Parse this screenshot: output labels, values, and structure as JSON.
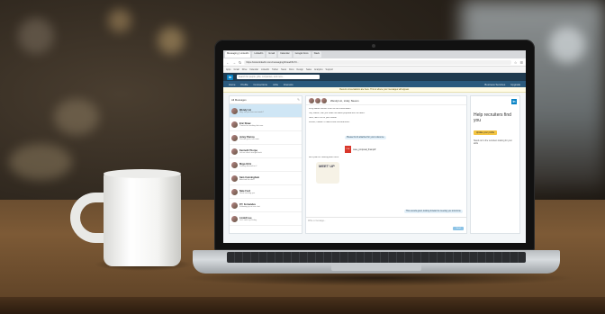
{
  "browser": {
    "tabs": [
      "Messaging | LinkedIn",
      "LinkedIn",
      "Gmail",
      "Calendar",
      "Google Docs",
      "Slack"
    ],
    "url": "https://www.linkedin.com/messaging/thread/6173...",
    "bookmarks": [
      "Apps",
      "Gmail",
      "Drive",
      "Calendar",
      "LinkedIn",
      "Twitter",
      "News",
      "Docs",
      "Design",
      "Sales",
      "Analytics",
      "Support"
    ]
  },
  "linkedin": {
    "logo": "in",
    "search_placeholder": "Search for people, jobs, companies, and more...",
    "nav": [
      "Home",
      "Profile",
      "Connections",
      "Jobs",
      "Interests"
    ],
    "nav_right": [
      "Business Services",
      "Upgrade"
    ],
    "banner": "Recent conversations are here. This is where your messages will appear."
  },
  "messaging": {
    "list_title": "All Messages",
    "conversations": [
      {
        "name": "Wendy Lin",
        "snippet": "Hey, are you free next week?",
        "date": ""
      },
      {
        "name": "Eric Shaw",
        "snippet": "Thanks for sending that over",
        "date": ""
      },
      {
        "name": "Jenny Ramos",
        "snippet": "Sounds great, talk soon",
        "date": ""
      },
      {
        "name": "Kenneth Thorpe",
        "snippet": "Let me check and get back",
        "date": ""
      },
      {
        "name": "Maya Ortiz",
        "snippet": "Looking forward to it!",
        "date": ""
      },
      {
        "name": "Sam Cunningham",
        "snippet": "Attached the deck",
        "date": ""
      },
      {
        "name": "Nate Ford",
        "snippet": "Great meeting you",
        "date": ""
      },
      {
        "name": "P.T. Fernandes",
        "snippet": "Following up on our chat",
        "date": ""
      },
      {
        "name": "Lindell Lee",
        "snippet": "Let's catch up Friday",
        "date": ""
      }
    ],
    "thread_title": "Wendy Lin, Lindy, Steven",
    "thread_lines": [
      "Lindy added Steven Chen to the conversation",
      "Hey Steven, can you share the latest proposal with the team?",
      "Sure, here it is for your review.",
      "Perfect, thanks! I'll take a look this afternoon.",
      "Let's plan on meeting after lunch."
    ],
    "bubble_1": "Please find it attached for your reference.",
    "pdf_name": "case_proposal_final.pdf",
    "sticker_text": "MEET UP",
    "bubble_2": "This sounds good, looking forward to meeting you tomorrow.",
    "compose_placeholder": "Write a message...",
    "send_label": "Send"
  },
  "ad": {
    "headline": "Help recruiters find you",
    "button": "Update your profile",
    "footer": "Stand out to the recruiters looking for your skills"
  },
  "colors": {
    "linkedin_blue": "#0a84c6",
    "nav_bar": "#2b5a7d",
    "active_conv": "#cfe6f5"
  }
}
